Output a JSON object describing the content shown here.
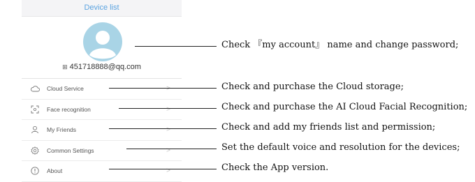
{
  "header": {
    "title": "Device list"
  },
  "account": {
    "qr_glyph": "⊞",
    "email": "451718888@qq.com"
  },
  "menu": [
    {
      "label": "Cloud Service",
      "icon": "cloud-icon"
    },
    {
      "label": "Face recognition",
      "icon": "face-scan-icon"
    },
    {
      "label": "My Friends",
      "icon": "person-icon"
    },
    {
      "label": "Common Settings",
      "icon": "gear-icon"
    },
    {
      "label": "About",
      "icon": "info-icon"
    }
  ],
  "chevron": ">",
  "annotations": [
    "Check 『my account』 name and change password;",
    "Check and purchase the Cloud storage;",
    "Check and purchase the AI Cloud Facial Recognition;",
    "Check and add my friends list and permission;",
    "Set the default voice and resolution for the devices;",
    "Check the App version."
  ],
  "colors": {
    "accent": "#5ba3e0",
    "avatar": "#a9d4e6",
    "header_bg": "#f4f4f6"
  }
}
